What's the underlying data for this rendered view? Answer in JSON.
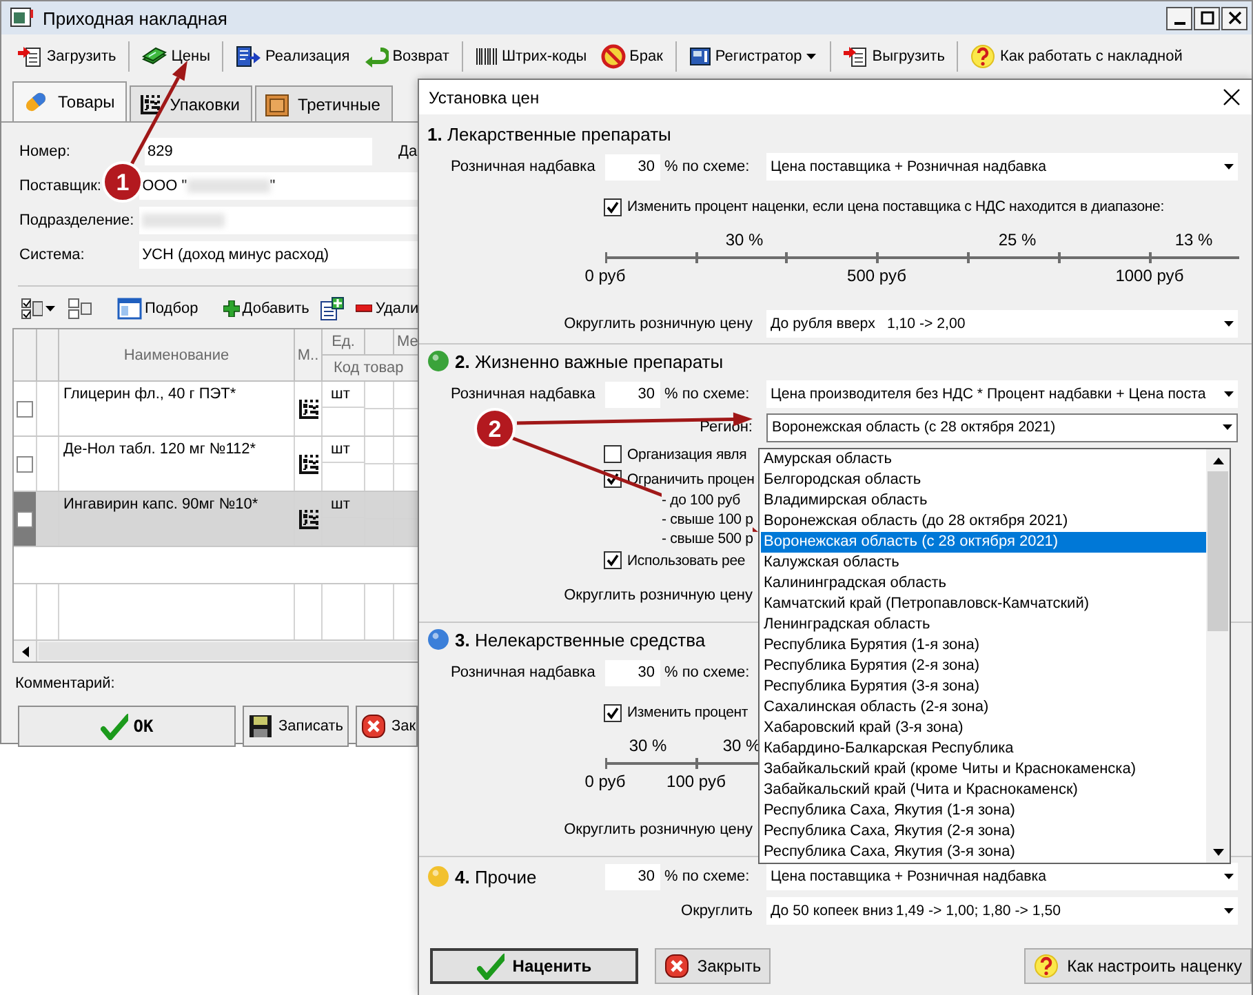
{
  "main_window": {
    "title": "Приходная накладная",
    "toolbar": [
      {
        "label": "Загрузить",
        "has_menu": false
      },
      {
        "label": "Цены",
        "has_menu": false
      },
      {
        "label": "Реализация",
        "has_menu": false
      },
      {
        "label": "Возврат",
        "has_menu": false
      },
      {
        "label": "Штрих-коды",
        "has_menu": false
      },
      {
        "label": "Брак",
        "has_menu": false
      },
      {
        "label": "Регистратор",
        "has_menu": true
      },
      {
        "label": "Выгрузить",
        "has_menu": false
      },
      {
        "label": "Как работать с накладной",
        "has_menu": false
      }
    ],
    "tabs": [
      {
        "label": "Товары",
        "selected": true
      },
      {
        "label": "Упаковки",
        "selected": false
      },
      {
        "label": "Третичные",
        "selected": false
      }
    ],
    "fields": [
      {
        "label": "Номер:",
        "value": "829",
        "redacted": false
      },
      {
        "label": "Поставщик:",
        "value": "ООО \"",
        "value_end": "\"",
        "redacted": true
      },
      {
        "label": "Подразделение:",
        "redacted": true
      },
      {
        "label": "Система:",
        "value": "УСН (доход минус расход)",
        "redacted": false
      }
    ],
    "date_label": "Да",
    "table_toolbar": [
      {
        "label": "Подбор"
      },
      {
        "label": "Добавить"
      },
      {
        "label": "Удали"
      }
    ],
    "table": {
      "columns": [
        "Наименование",
        "М..",
        "Ед.",
        "Ме"
      ],
      "subheader": "Код товар",
      "rows": [
        {
          "checked": false,
          "selected": false,
          "name": "Глицерин фл., 40 г ПЭТ*",
          "unit": "шт"
        },
        {
          "checked": false,
          "selected": false,
          "name": "Де-Нол табл. 120 мг №112*",
          "unit": "шт"
        },
        {
          "checked": false,
          "selected": true,
          "name": "Ингавирин капс. 90мг №10*",
          "unit": "шт"
        }
      ]
    },
    "comment_label": "Комментарий:",
    "buttons": [
      {
        "label": "OK"
      },
      {
        "label": "Записать"
      },
      {
        "label": "Зак"
      }
    ]
  },
  "dialog": {
    "title": "Установка цен",
    "sections": [
      {
        "heading": "**1.** Лекарственные препараты",
        "markup_label": "Розничная надбавка",
        "markup": "30",
        "scheme_label": "% по схеме:",
        "scheme": "Цена поставщика + Розничная надбавка",
        "checks": [
          {
            "label": "Изменить процент наценки, если цена поставщика с НДС находится в диапазоне:",
            "checked": true
          }
        ],
        "scale": {
          "rates": [
            "30 %",
            "25 %",
            "13 %"
          ],
          "prices": [
            "0 руб",
            "500 руб",
            "1000 руб"
          ]
        },
        "rounding_label": "Округлить розничную цену",
        "rounding": {
          "value": "До рубля вверх",
          "example": "1,10 -> 2,00"
        }
      },
      {
        "heading": "**2.** Жизненно важные препараты",
        "color": "#3aa33a",
        "markup_label": "Розничная надбавка",
        "markup": "30",
        "scheme_label": "% по схеме:",
        "scheme": "Цена производителя без НДС * Процент надбавки + Цена поста",
        "region_label": "Регион:",
        "region": "Воронежская область (с 28 октября 2021)",
        "checks": [
          {
            "label": "Организация явля",
            "checked": false
          },
          {
            "label": "Ограничить процен",
            "checked": true,
            "lines": [
              "- до 100 руб",
              "- свыше 100 р",
              "- свыше 500 р"
            ]
          },
          {
            "label": "Использовать рее",
            "checked": true
          }
        ],
        "rounding_label": "Округлить розничную цену"
      },
      {
        "heading": "**3.** Нелекарственные средства",
        "color": "#3b7fd9",
        "markup_label": "Розничная надбавка",
        "markup": "30",
        "scheme_label": "% по схеме:",
        "checks": [
          {
            "label": "Изменить процент",
            "checked": true
          }
        ],
        "scale": {
          "rates": [
            "30 %",
            "30 %"
          ],
          "prices": [
            "0 руб",
            "100 руб"
          ]
        },
        "rounding_label": "Округлить розничную цену"
      },
      {
        "heading": "**4.** Прочие",
        "color": "#f2c12e",
        "markup": "30",
        "scheme_label": "% по схеме:",
        "scheme": "Цена поставщика + Розничная надбавка",
        "rounding_label": "Округлить",
        "rounding": {
          "value": "До 50 копеек вниз",
          "example": "1,49 -> 1,00;  1,80 -> 1,50"
        }
      }
    ],
    "buttons": [
      {
        "label": "Наценить"
      },
      {
        "label": "Закрыть"
      },
      {
        "label": "Как настроить наценку"
      }
    ],
    "region_list": [
      {
        "label": "Амурская область",
        "selected": false
      },
      {
        "label": "Белгородская область",
        "selected": false
      },
      {
        "label": "Владимирская область",
        "selected": false
      },
      {
        "label": "Воронежская область (до 28 октября 2021)",
        "selected": false
      },
      {
        "label": "Воронежская область (с 28 октября 2021)",
        "selected": true
      },
      {
        "label": "Калужская область",
        "selected": false
      },
      {
        "label": "Калининградская область",
        "selected": false
      },
      {
        "label": "Камчатский край (Петропавловск-Камчатский)",
        "selected": false
      },
      {
        "label": "Ленинградская область",
        "selected": false
      },
      {
        "label": "Республика Бурятия (1-я зона)",
        "selected": false
      },
      {
        "label": "Республика Бурятия (2-я зона)",
        "selected": false
      },
      {
        "label": "Республика Бурятия (3-я зона)",
        "selected": false
      },
      {
        "label": "Сахалинская область (2-я зона)",
        "selected": false
      },
      {
        "label": "Хабаровский край (3-я зона)",
        "selected": false
      },
      {
        "label": "Кабардино-Балкарская Республика",
        "selected": false
      },
      {
        "label": "Забайкальский край (кроме Читы и Краснокаменска)",
        "selected": false
      },
      {
        "label": "Забайкальский край (Чита и Краснокаменск)",
        "selected": false
      },
      {
        "label": "Республика Саха, Якутия (1-я зона)",
        "selected": false
      },
      {
        "label": "Республика Саха, Якутия (2-я зона)",
        "selected": false
      },
      {
        "label": "Республика Саха, Якутия (3-я зона)",
        "selected": false
      }
    ]
  },
  "annotations": [
    {
      "label": "1"
    },
    {
      "label": "2"
    }
  ]
}
